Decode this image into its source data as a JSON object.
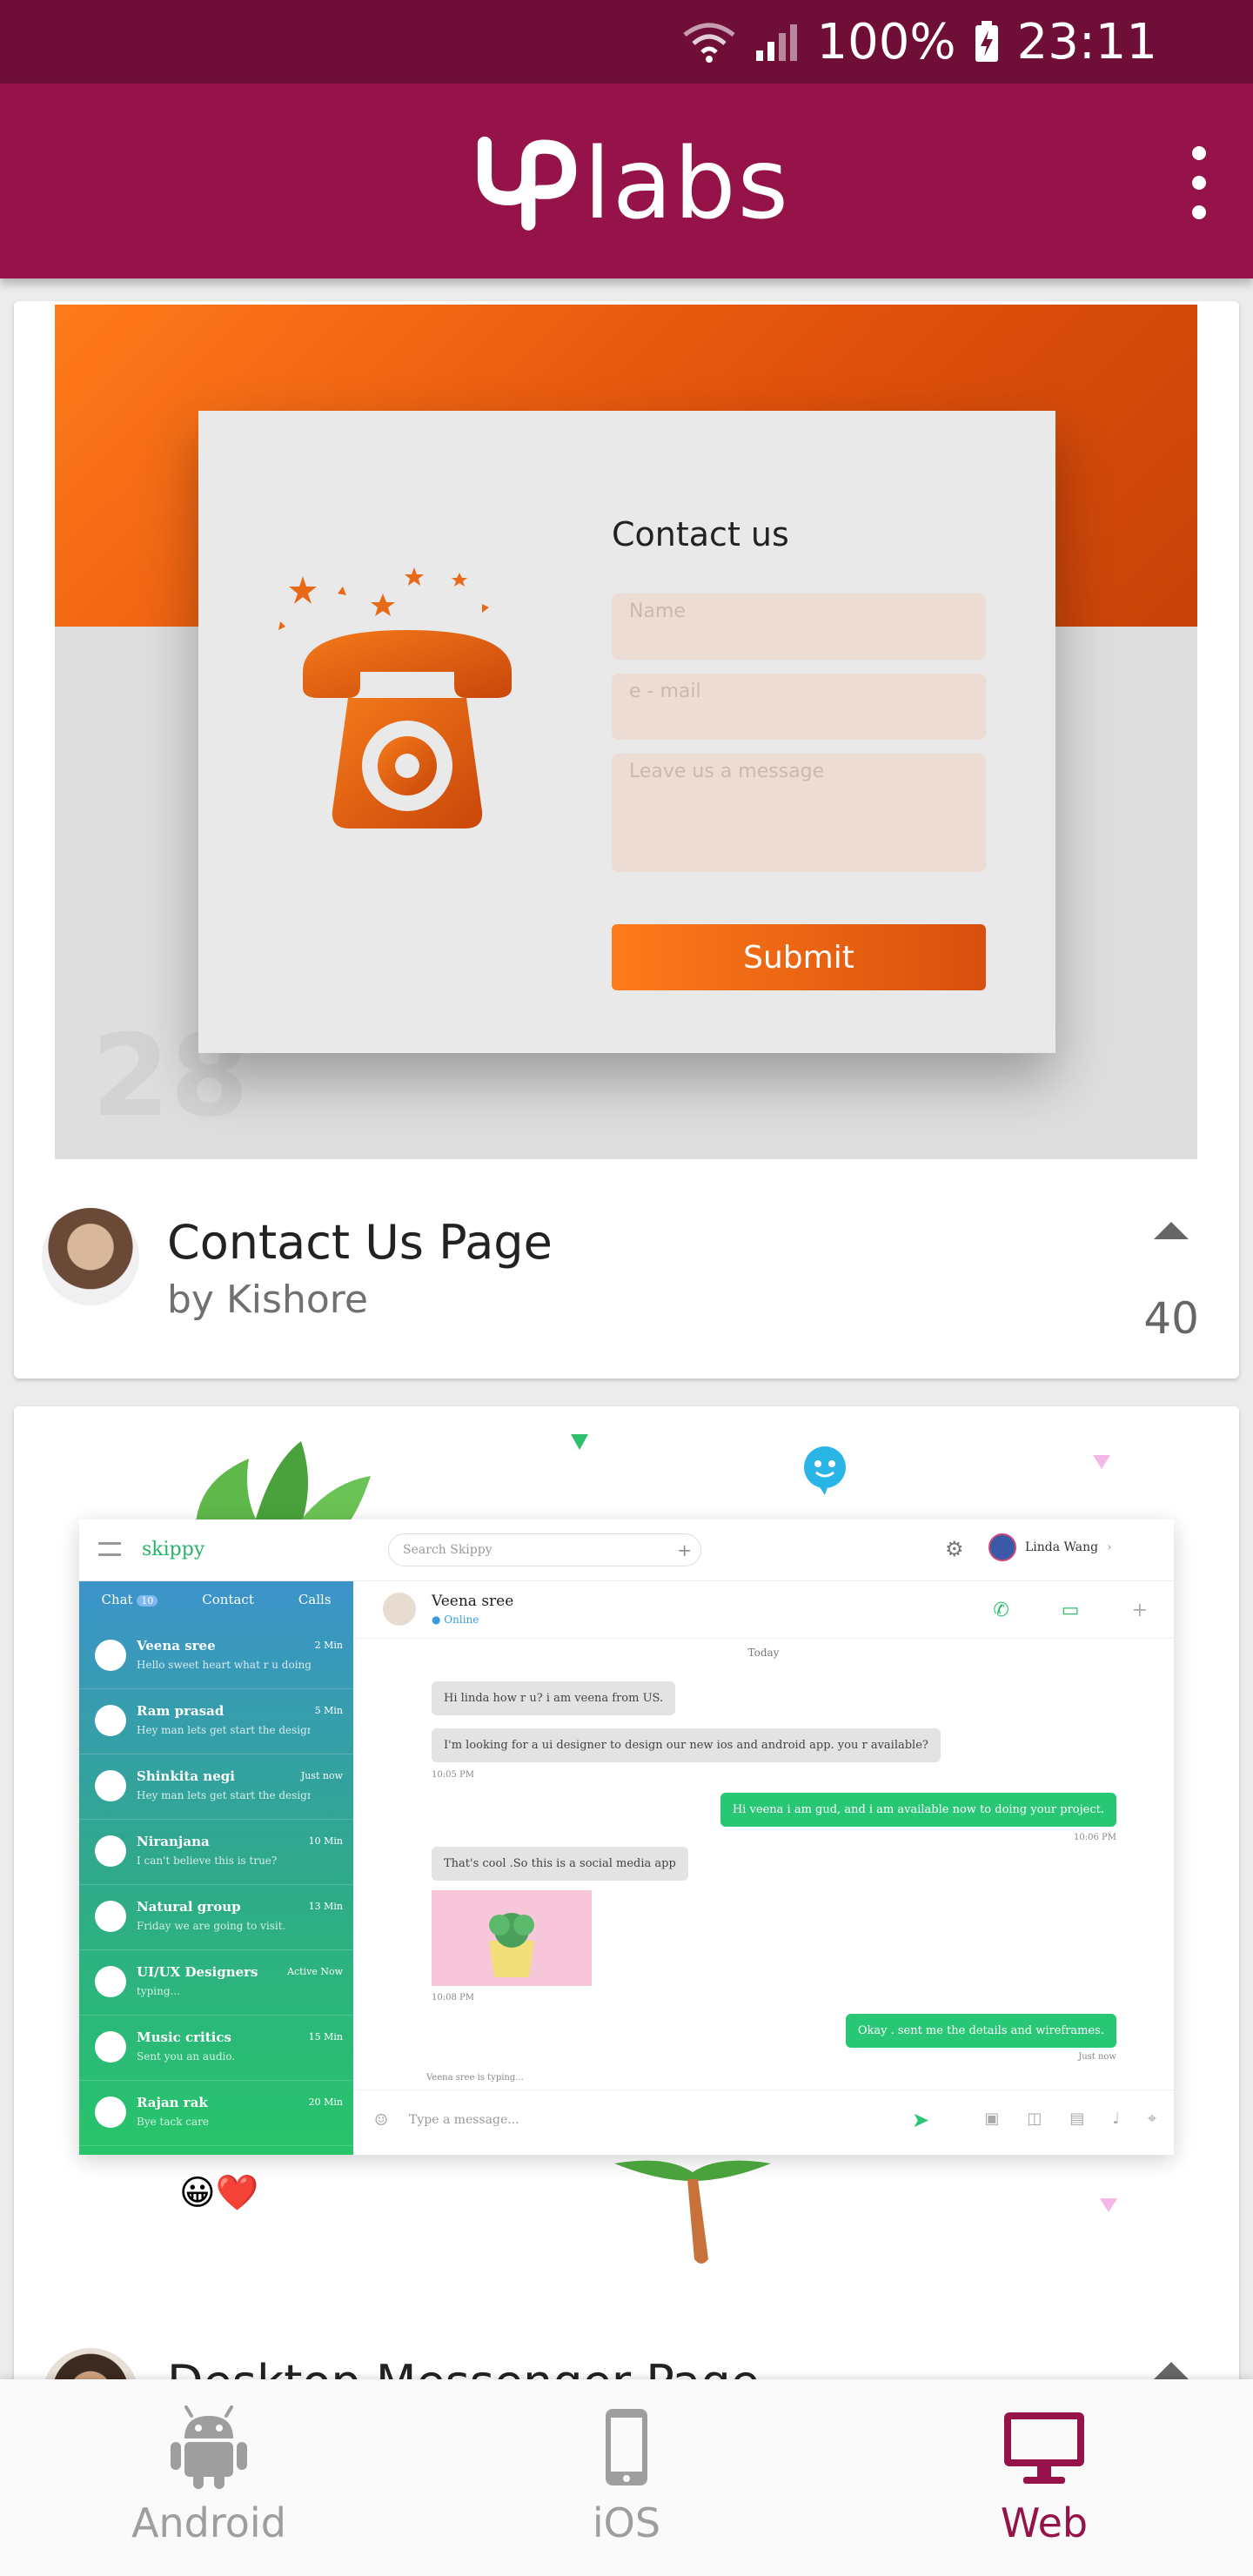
{
  "status_bar": {
    "battery": "100%",
    "time": "23:11"
  },
  "app_bar": {
    "logo_text": "labs"
  },
  "cards": [
    {
      "title": "Contact Us Page",
      "author": "by Kishore",
      "votes": "40",
      "preview": {
        "heading": "Contact us",
        "name_placeholder": "Name",
        "email_placeholder": "e - mail",
        "message_placeholder": "Leave us a message",
        "submit_label": "Submit",
        "watermark": "28"
      }
    },
    {
      "title": "Desktop Messenger Page",
      "preview": {
        "app_name": "skippy",
        "search_placeholder": "Search Skippy",
        "user_name": "Linda Wang",
        "tabs": [
          "Chat",
          "Contact",
          "Calls"
        ],
        "chat_badge": "10",
        "contacts": [
          {
            "name": "Veena sree",
            "sub": "Hello sweet heart what r u doing?",
            "time": "2 Min"
          },
          {
            "name": "Ram prasad",
            "sub": "Hey man lets get start the design we ...",
            "time": "5 Min"
          },
          {
            "name": "Shinkita negi",
            "sub": "Hey man lets get start the design we ...",
            "time": "Just now"
          },
          {
            "name": "Niranjana",
            "sub": "I can't believe this is true?",
            "time": "10 Min"
          },
          {
            "name": "Natural group",
            "sub": "Friday we are going to visit.",
            "time": "13 Min"
          },
          {
            "name": "UI/UX Designers",
            "sub": "typing...",
            "time": "Active Now"
          },
          {
            "name": "Music critics",
            "sub": "Sent you an audio.",
            "time": "15 Min"
          },
          {
            "name": "Rajan rak",
            "sub": "Bye tack care",
            "time": "20 Min"
          }
        ],
        "chat_with": "Veena sree",
        "chat_status": "Online",
        "day_label": "Today",
        "messages": {
          "m1": "Hi linda how r u? i am veena from US.",
          "m2": "I'm looking for a ui designer to design our new ios and android app. you r available?",
          "t1": "10:05 PM",
          "m3": "Hi veena i am gud, and i am available now to doing your project.",
          "t2": "10:06 PM",
          "m4": "That's cool .So this is a social media app",
          "t3": "10:08 PM",
          "m5": "Okay . sent me the details and wireframes.",
          "t4": "Just now",
          "typing": "Veena sree is typing..."
        },
        "compose_placeholder": "Type a message..."
      }
    }
  ],
  "bottom_nav": [
    {
      "label": "Android",
      "icon": "android-icon"
    },
    {
      "label": "iOS",
      "icon": "phone-icon"
    },
    {
      "label": "Web",
      "icon": "monitor-icon"
    }
  ],
  "colors": {
    "primary": "#951348",
    "primary_dark": "#6f0f37",
    "accent_orange": "#f26d14",
    "chat_green": "#28c773"
  }
}
